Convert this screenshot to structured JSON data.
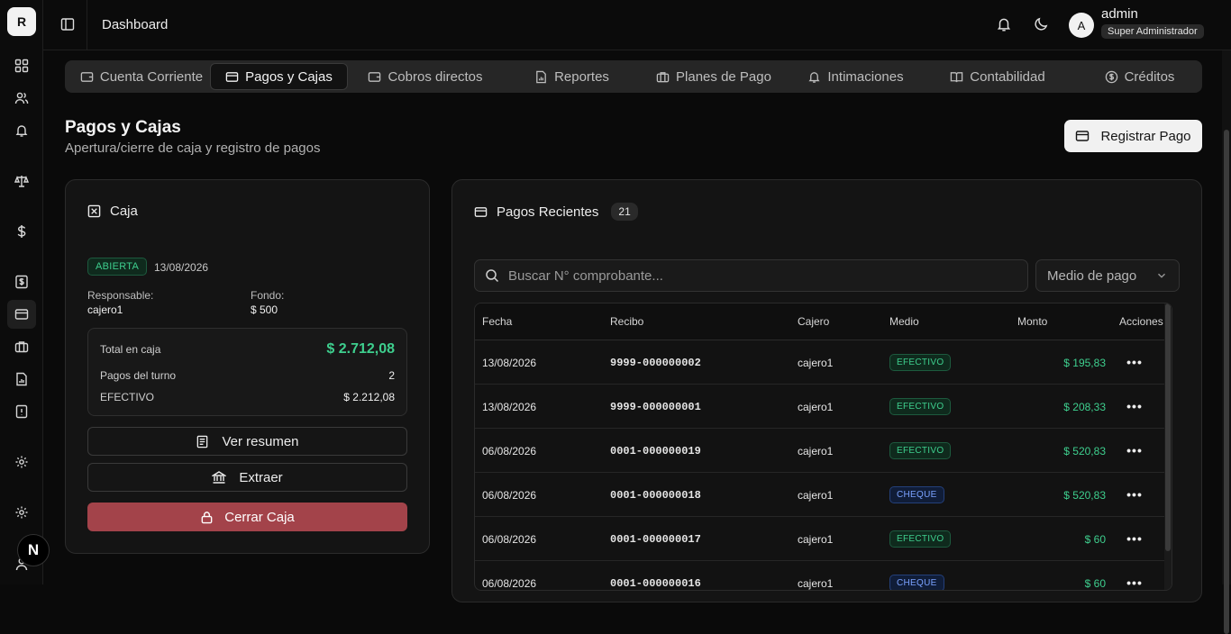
{
  "app": {
    "logo_letter": "R",
    "next_badge": "N"
  },
  "header": {
    "breadcrumb": "Dashboard",
    "user": {
      "avatar_letter": "A",
      "name": "admin",
      "role": "Super Administrador"
    }
  },
  "tabs": [
    {
      "label": "Cuenta Corriente",
      "icon": "wallet-icon"
    },
    {
      "label": "Pagos y Cajas",
      "icon": "credit-card-icon",
      "active": true
    },
    {
      "label": "Cobros directos",
      "icon": "wallet-icon"
    },
    {
      "label": "Reportes",
      "icon": "report-icon"
    },
    {
      "label": "Planes de Pago",
      "icon": "briefcase-icon"
    },
    {
      "label": "Intimaciones",
      "icon": "bell-icon"
    },
    {
      "label": "Contabilidad",
      "icon": "book-icon"
    },
    {
      "label": "Créditos",
      "icon": "dollar-circle-icon"
    }
  ],
  "page": {
    "title": "Pagos y Cajas",
    "subtitle": "Apertura/cierre de caja y registro de pagos",
    "register_button": "Registrar Pago"
  },
  "caja": {
    "title": "Caja",
    "status": "ABIERTA",
    "date": "13/08/2026",
    "responsable_label": "Responsable:",
    "responsable_value": "cajero1",
    "fondo_label": "Fondo:",
    "fondo_value": "$ 500",
    "total_label": "Total en caja",
    "total_value": "$ 2.712,08",
    "pagos_label": "Pagos del turno",
    "pagos_value": "2",
    "efectivo_label": "EFECTIVO",
    "efectivo_value": "$ 2.212,08",
    "ver_resumen": "Ver resumen",
    "extraer": "Extraer",
    "cerrar": "Cerrar Caja"
  },
  "recientes": {
    "title": "Pagos Recientes",
    "count": "21",
    "search_placeholder": "Buscar N° comprobante...",
    "medio_select": "Medio de pago",
    "columns": [
      "Fecha",
      "Recibo",
      "Cajero",
      "Medio",
      "Monto",
      "Acciones"
    ],
    "rows": [
      {
        "fecha": "13/08/2026",
        "recibo": "9999-000000002",
        "cajero": "cajero1",
        "medio": "EFECTIVO",
        "monto": "$ 195,83"
      },
      {
        "fecha": "13/08/2026",
        "recibo": "9999-000000001",
        "cajero": "cajero1",
        "medio": "EFECTIVO",
        "monto": "$ 208,33"
      },
      {
        "fecha": "06/08/2026",
        "recibo": "0001-000000019",
        "cajero": "cajero1",
        "medio": "EFECTIVO",
        "monto": "$ 520,83"
      },
      {
        "fecha": "06/08/2026",
        "recibo": "0001-000000018",
        "cajero": "cajero1",
        "medio": "CHEQUE",
        "monto": "$ 520,83"
      },
      {
        "fecha": "06/08/2026",
        "recibo": "0001-000000017",
        "cajero": "cajero1",
        "medio": "EFECTIVO",
        "monto": "$ 60"
      },
      {
        "fecha": "06/08/2026",
        "recibo": "0001-000000016",
        "cajero": "cajero1",
        "medio": "CHEQUE",
        "monto": "$ 60"
      }
    ]
  },
  "colors": {
    "accent_green": "#3ecf8e",
    "danger": "#a3434a",
    "cheque_blue": "#7aa2ff"
  }
}
